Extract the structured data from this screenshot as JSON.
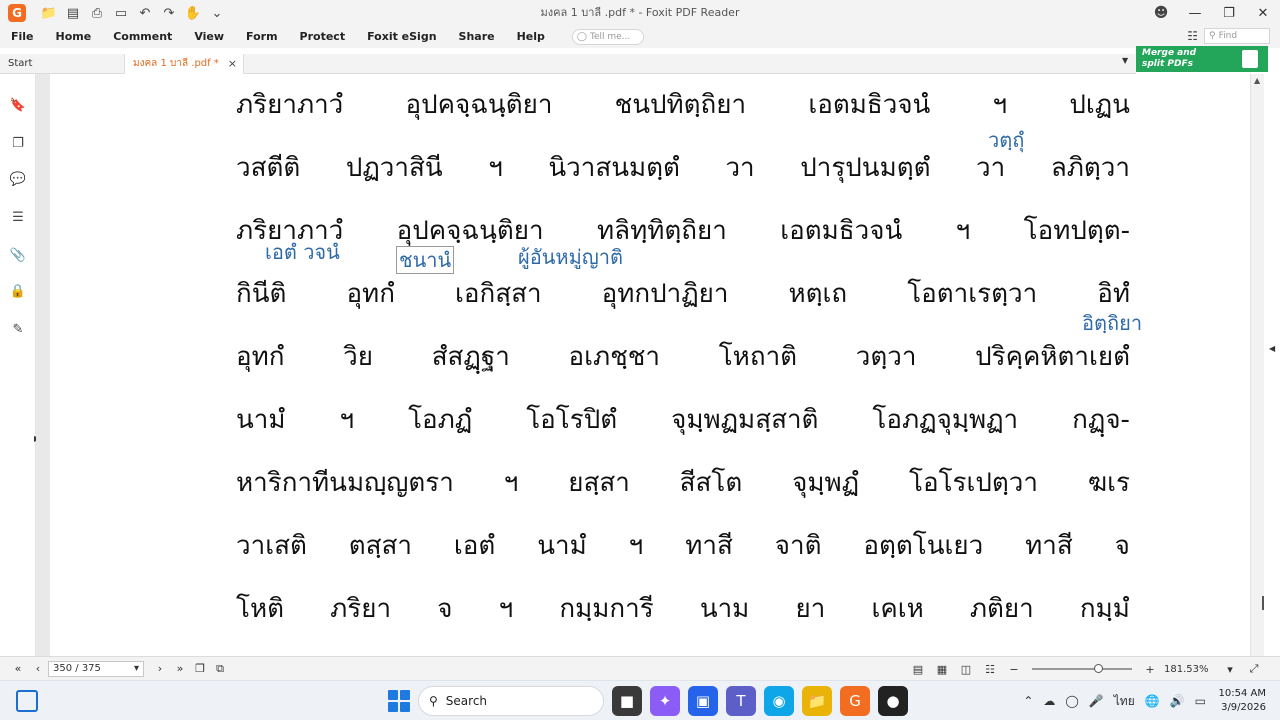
{
  "window": {
    "title": "มงคล 1 บาลี .pdf * - Foxit PDF Reader",
    "app_logo": "G"
  },
  "menu": [
    "File",
    "Home",
    "Comment",
    "View",
    "Form",
    "Protect",
    "Foxit eSign",
    "Share",
    "Help"
  ],
  "tellme_placeholder": "Tell me...",
  "find_placeholder": "Find",
  "ad": {
    "line1": "Merge and",
    "line2": "split PDFs"
  },
  "tabs": {
    "start": "Start",
    "doc": "มงคล 1 บาลี .pdf *",
    "close": "×"
  },
  "document": {
    "lines": [
      [
        "ภริยาภาวํ",
        "อุปคจฺฉนฺติยา",
        "ชนปทิตฺถิยา",
        "เอตมธิวจนํ",
        "ฯ",
        "ปเฏน"
      ],
      [
        "วสตีติ",
        "ปฏวาสินี",
        "ฯ",
        "นิวาสนมตฺตํ",
        "วา",
        "ปารุปนมตฺตํ",
        "วา",
        "ลภิตฺวา"
      ],
      [
        "ภริยาภาวํ",
        "อุปคจฺฉนฺติยา",
        "ทลิทฺทิตฺถิยา",
        "เอตมธิวจนํ",
        "ฯ",
        "โอทปตฺต-"
      ],
      [
        "กินีติ",
        "อุทกํ",
        "เอกิสฺสา",
        "อุทกปาฏิยา",
        "หตฺเถ",
        "โอตาเรตฺวา",
        "อิทํ"
      ],
      [
        "อุทกํ",
        "วิย",
        "สํสฏฺฐา",
        "อเภชฺชา",
        "โหถาติ",
        "วตฺวา",
        "ปริคฺคหิตาเยตํ"
      ],
      [
        "นามํ",
        "ฯ",
        "โอภฏํ",
        "โอโรปิตํ",
        "จุมฺพฏมสฺสาติ",
        "โอภฏจุมฺพฏา",
        "กฏฺจ-"
      ],
      [
        "หาริกาทีนมญฺญตรา",
        "ฯ",
        "ยสฺสา",
        "สีสโต",
        "จุมฺพฏํ",
        "โอโรเปตฺวา",
        "ฆเร"
      ],
      [
        "วาเสติ",
        "ตสฺสา",
        "เอตํ",
        "นามํ",
        "ฯ",
        "ทาสี",
        "จาติ",
        "อตฺตโนเยว",
        "ทาสี",
        "จ"
      ],
      [
        "โหติ",
        "ภริยา",
        "จ",
        "ฯ",
        "กมฺมการี",
        "นาม",
        "ยา",
        "เคเห",
        "ภติยา",
        "กมฺมํ"
      ]
    ],
    "annotations": {
      "vatthu": "วตฺถุํ",
      "eta_vacana": "เอตํ วจนํ",
      "chanana": "ชนานํ",
      "phu_an_mu_yat": "ผู้อันหมู่ญาติ",
      "itthiya": "อิตฺถิยา"
    }
  },
  "statusbar": {
    "page": "350 / 375",
    "zoom": "181.53%"
  },
  "taskbar": {
    "search": "Search",
    "ime": "ไทย",
    "time": "10:54 AM",
    "date": "3/9/2026"
  }
}
